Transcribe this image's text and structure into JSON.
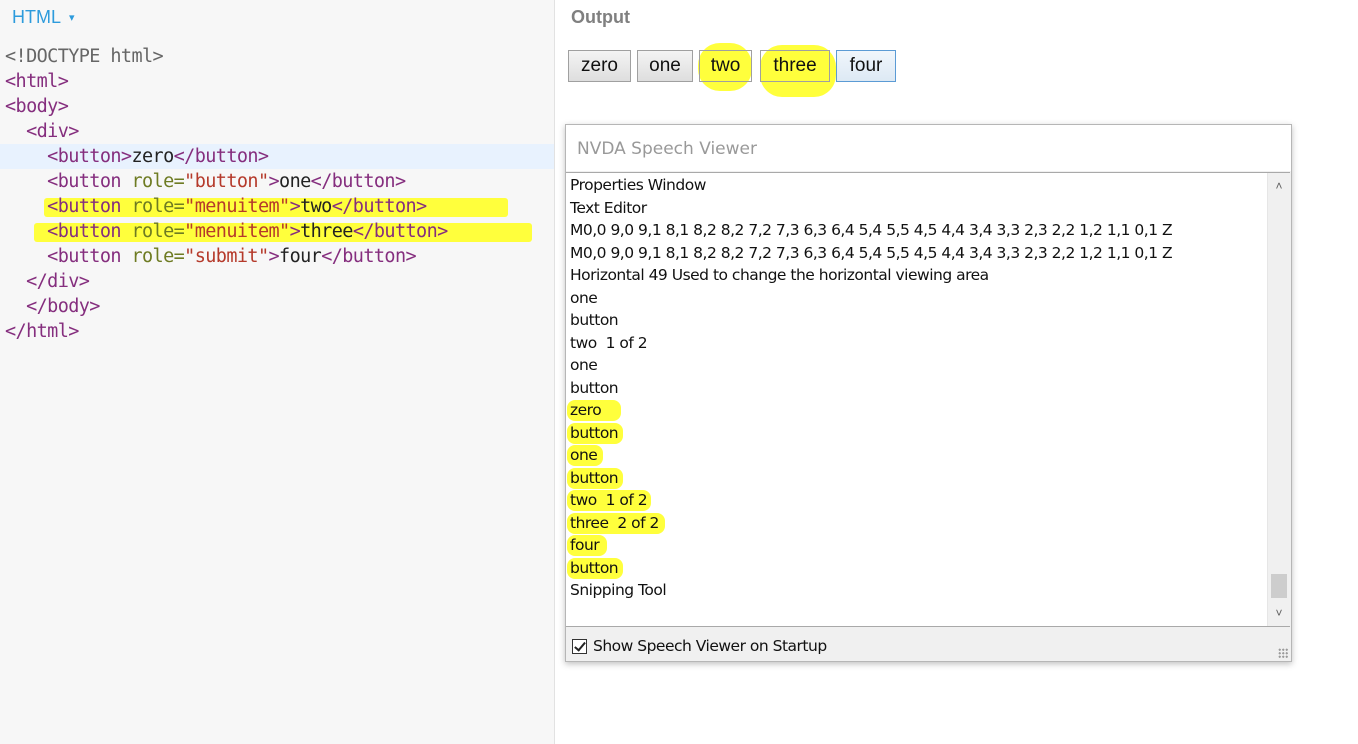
{
  "editor": {
    "language_label": "HTML",
    "language_caret": "▾",
    "lines": [
      [
        {
          "t": "<!DOCTYPE html>",
          "c": "doctype"
        }
      ],
      [
        {
          "t": "<html>",
          "c": "tag"
        }
      ],
      [
        {
          "t": "<body>",
          "c": "tag"
        }
      ],
      [
        {
          "t": "  ",
          "c": "text"
        },
        {
          "t": "<div>",
          "c": "tag"
        }
      ],
      [
        {
          "t": "    ",
          "c": "text"
        },
        {
          "t": "<button>",
          "c": "tag"
        },
        {
          "t": "zero",
          "c": "text"
        },
        {
          "t": "</button>",
          "c": "tag"
        }
      ],
      [
        {
          "t": "    ",
          "c": "text"
        },
        {
          "t": "<button ",
          "c": "tag"
        },
        {
          "t": "role=",
          "c": "attr"
        },
        {
          "t": "\"button\"",
          "c": "str"
        },
        {
          "t": ">",
          "c": "tag"
        },
        {
          "t": "one",
          "c": "text"
        },
        {
          "t": "</button>",
          "c": "tag"
        }
      ],
      [
        {
          "t": "    ",
          "c": "text"
        },
        {
          "t": "<button ",
          "c": "tag"
        },
        {
          "t": "role=",
          "c": "attr"
        },
        {
          "t": "\"menuitem\"",
          "c": "str"
        },
        {
          "t": ">",
          "c": "tag"
        },
        {
          "t": "two",
          "c": "text"
        },
        {
          "t": "</button>",
          "c": "tag"
        }
      ],
      [
        {
          "t": "    ",
          "c": "text"
        },
        {
          "t": "<button ",
          "c": "tag"
        },
        {
          "t": "role=",
          "c": "attr"
        },
        {
          "t": "\"menuitem\"",
          "c": "str"
        },
        {
          "t": ">",
          "c": "tag"
        },
        {
          "t": "three",
          "c": "text"
        },
        {
          "t": "</button>",
          "c": "tag"
        }
      ],
      [
        {
          "t": "    ",
          "c": "text"
        },
        {
          "t": "<button ",
          "c": "tag"
        },
        {
          "t": "role=",
          "c": "attr"
        },
        {
          "t": "\"submit\"",
          "c": "str"
        },
        {
          "t": ">",
          "c": "tag"
        },
        {
          "t": "four",
          "c": "text"
        },
        {
          "t": "</button>",
          "c": "tag"
        }
      ],
      [
        {
          "t": "  ",
          "c": "text"
        },
        {
          "t": "</div>",
          "c": "tag"
        }
      ],
      [
        {
          "t": "  ",
          "c": "text"
        },
        {
          "t": "</body>",
          "c": "tag"
        }
      ],
      [
        {
          "t": "</html>",
          "c": "tag"
        }
      ]
    ]
  },
  "output": {
    "title": "Output",
    "buttons": [
      "zero",
      "one",
      "two",
      "three",
      "four"
    ]
  },
  "speech_viewer": {
    "title": "NVDA Speech Viewer",
    "lines": [
      "Properties Window",
      "Text Editor",
      "M0,0 9,0 9,1 8,1 8,2 8,2 7,2 7,3 6,3 6,4 5,4 5,5 4,5 4,4 3,4 3,3 2,3 2,2 1,2 1,1 0,1 Z",
      "M0,0 9,0 9,1 8,1 8,2 8,2 7,2 7,3 6,3 6,4 5,4 5,5 4,5 4,4 3,4 3,3 2,3 2,2 1,2 1,1 0,1 Z",
      "Horizontal 49 Used to change the horizontal viewing area",
      "one",
      "button",
      "two  1 of 2",
      "one",
      "button",
      "zero",
      "button",
      "one",
      "button",
      "two  1 of 2",
      "three  2 of 2",
      "four",
      "button",
      "Snipping Tool"
    ],
    "startup_checkbox_label": "Show Speech Viewer on Startup",
    "startup_checked": true
  },
  "colors": {
    "highlight": "#ffff3c",
    "editor_header": "#2d9bdc",
    "tag": "#852e7e",
    "attr": "#6e7b22",
    "string": "#b53a2b"
  }
}
